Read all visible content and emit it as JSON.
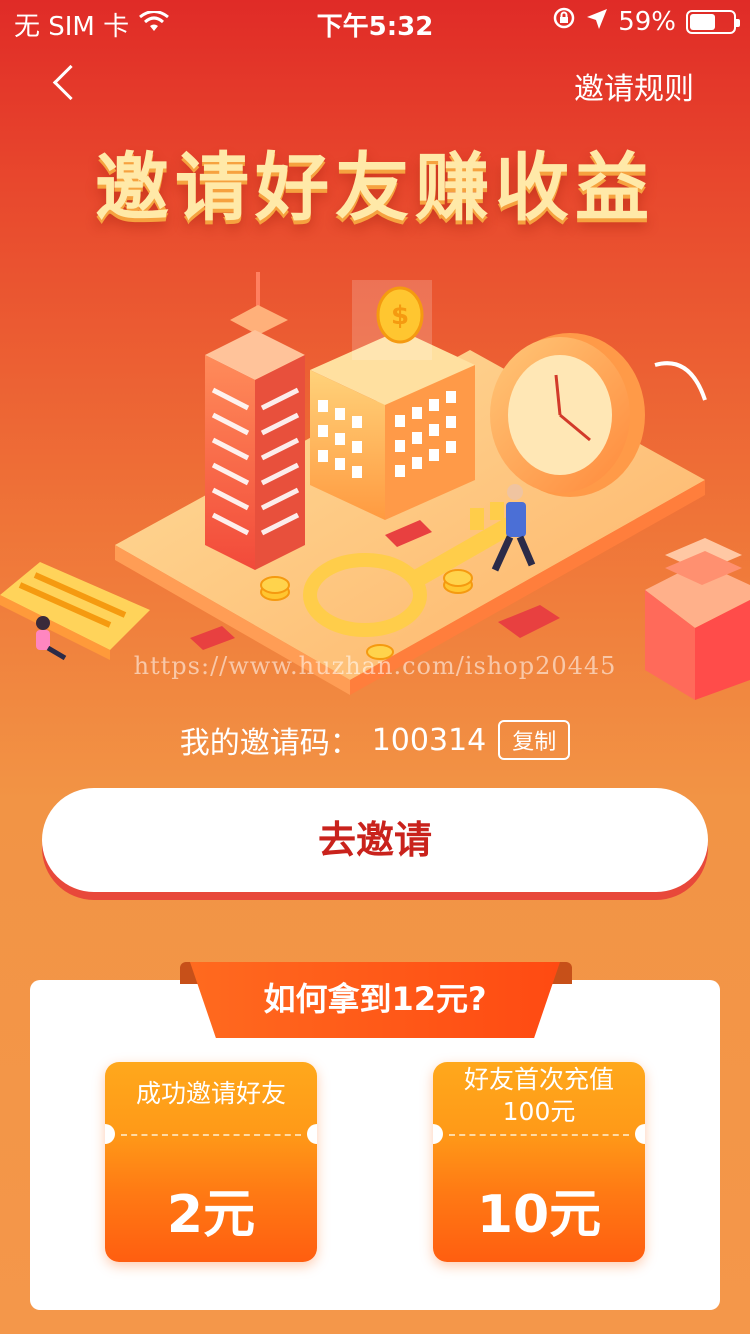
{
  "status_bar": {
    "carrier": "无 SIM 卡",
    "time": "下午5:32",
    "battery_percent": "59%",
    "battery_level": 0.59,
    "icons": [
      "wifi-icon",
      "orientation-lock-icon",
      "location-icon",
      "battery-icon"
    ]
  },
  "nav": {
    "back_icon": "chevron-left-icon",
    "rules_label": "邀请规则"
  },
  "hero": {
    "title": "邀请好友赚收益"
  },
  "watermark": "https://www.huzhan.com/ishop20445",
  "invite": {
    "code_label": "我的邀请码：",
    "code_value": "100314",
    "copy_label": "复制",
    "button_label": "去邀请"
  },
  "how_to": {
    "title": "如何拿到12元?",
    "rewards": [
      {
        "label": "成功邀请好友",
        "amount": "2元"
      },
      {
        "label": "好友首次充值100元",
        "amount": "10元"
      }
    ]
  },
  "colors": {
    "primary_red": "#e02b27",
    "button_text": "#c9221c",
    "ribbon_orange": "#ff5a17",
    "coupon_top": "#ffa81c",
    "coupon_bottom": "#ff5e10"
  }
}
